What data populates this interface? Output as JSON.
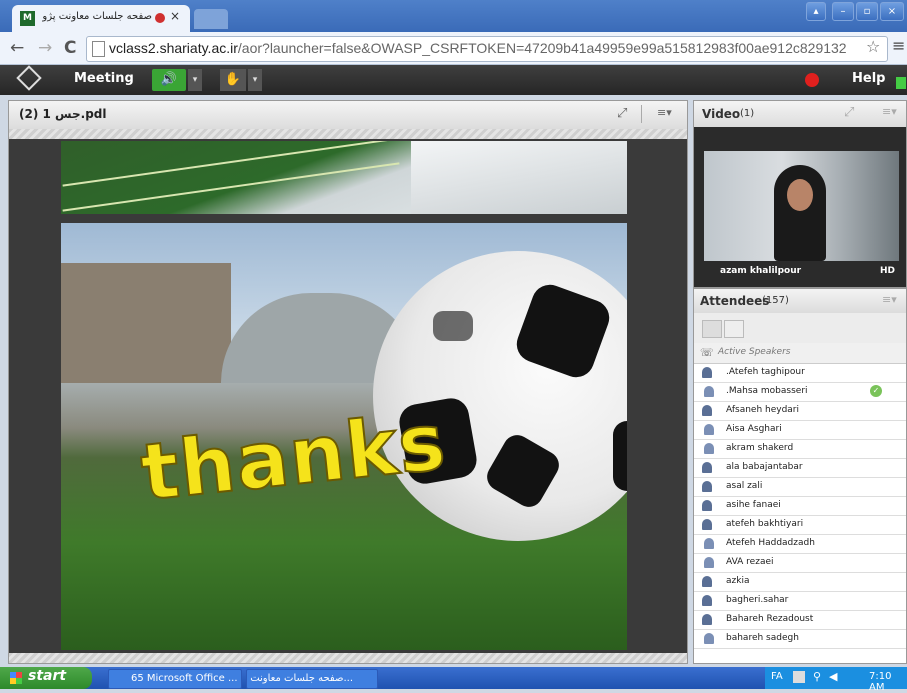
{
  "browser": {
    "tab_title": "صفحه جلسات معاونت پژو...",
    "tab_close": "×",
    "url_host": "vclass2.shariaty.ac.ir",
    "url_path": "/aor?launcher=false&OWASP_CSRFTOKEN=47209b41a49959e99a515812983f00ae912c829132",
    "nav_back": "←",
    "nav_forward": "→",
    "reload": "C"
  },
  "app": {
    "meeting_label": "Meeting",
    "help_label": "Help",
    "speaker_icon": "speaker-icon",
    "mic_icon": "mic-icon",
    "dropdown_glyph": "▾"
  },
  "pdf_pod": {
    "title": "(2) 1 جس.pdl",
    "slide_text": "thanks",
    "fullscreen_icon": "⤢",
    "menu_icon": "≡▾"
  },
  "video_pod": {
    "title": "Video",
    "count": "(1)",
    "presenter_name": "azam khalilpour",
    "quality": "HD"
  },
  "attendees_pod": {
    "title": "Attendees",
    "count": "(157)",
    "active_speakers_label": "Active Speakers",
    "attendees": [
      {
        "name": ".Atefeh taghipour",
        "icon": "user-group"
      },
      {
        "name": ".Mahsa mobasseri",
        "icon": "user",
        "status": "✓"
      },
      {
        "name": "Afsaneh heydari",
        "icon": "user-group"
      },
      {
        "name": "Aisa Asghari",
        "icon": "user"
      },
      {
        "name": "akram shakerd",
        "icon": "user"
      },
      {
        "name": "ala babajantabar",
        "icon": "user-group"
      },
      {
        "name": "asal zali",
        "icon": "user-group"
      },
      {
        "name": "asihe fanaei",
        "icon": "user-group"
      },
      {
        "name": "atefeh bakhtiyari",
        "icon": "user-group"
      },
      {
        "name": "Atefeh Haddadzadh",
        "icon": "user"
      },
      {
        "name": "AVA rezaei",
        "icon": "user"
      },
      {
        "name": "azkia",
        "icon": "user-group"
      },
      {
        "name": "bagheri.sahar",
        "icon": "user-group"
      },
      {
        "name": "Bahareh Rezadoust",
        "icon": "user-group"
      },
      {
        "name": "bahareh sadegh",
        "icon": "user"
      }
    ]
  },
  "taskbar": {
    "start_label": "start",
    "task1": "65 Microsoft Office ...",
    "task2": "...صفحه جلسات معاونت",
    "lang": "FA",
    "time": "7:10 AM"
  }
}
